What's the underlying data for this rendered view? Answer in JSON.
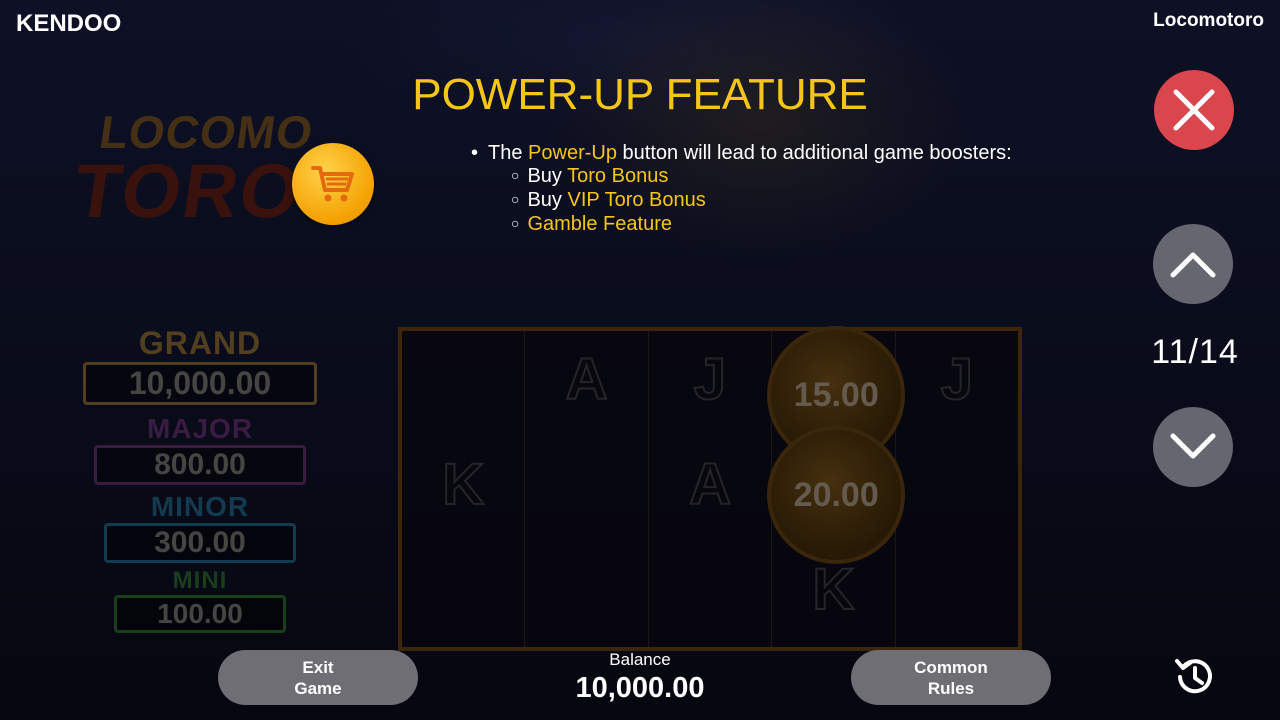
{
  "header": {
    "brand": "KENDOO",
    "game_name": "Locomotoro"
  },
  "background": {
    "logo_line1": "LOCOMO",
    "logo_line2": "TORO",
    "jackpots": [
      {
        "label": "GRAND",
        "value": "10,000.00",
        "color": "#d4a548"
      },
      {
        "label": "MAJOR",
        "value": "800.00",
        "color": "#8b3fa0"
      },
      {
        "label": "MINOR",
        "value": "300.00",
        "color": "#2c8bbf"
      },
      {
        "label": "MINI",
        "value": "100.00",
        "color": "#3a9c3a"
      }
    ],
    "reels": [
      {
        "symbols": [
          "",
          "K",
          ""
        ]
      },
      {
        "symbols": [
          "A",
          "",
          ""
        ]
      },
      {
        "symbols": [
          "J",
          "A",
          ""
        ]
      },
      {
        "symbols": [
          "",
          "",
          "K"
        ],
        "coins": [
          "15.00",
          "20.00"
        ]
      },
      {
        "symbols": [
          "J",
          "",
          ""
        ]
      }
    ]
  },
  "help": {
    "title": "POWER-UP FEATURE",
    "bullet_prefix": "The ",
    "bullet_highlight": "Power-Up",
    "bullet_suffix": " button will lead to additional game boosters:",
    "subitems": [
      {
        "prefix": "Buy ",
        "highlight": "Toro Bonus"
      },
      {
        "prefix": "Buy ",
        "highlight": "VIP Toro Bonus"
      },
      {
        "prefix": "",
        "highlight": "Gamble Feature"
      }
    ]
  },
  "pagination": {
    "current": "11/14"
  },
  "footer": {
    "exit_line1": "Exit",
    "exit_line2": "Game",
    "balance_label": "Balance",
    "balance_value": "10,000.00",
    "rules_line1": "Common",
    "rules_line2": "Rules"
  },
  "colors": {
    "accent": "#f5c518",
    "close": "#d9464e",
    "button": "#666670"
  }
}
